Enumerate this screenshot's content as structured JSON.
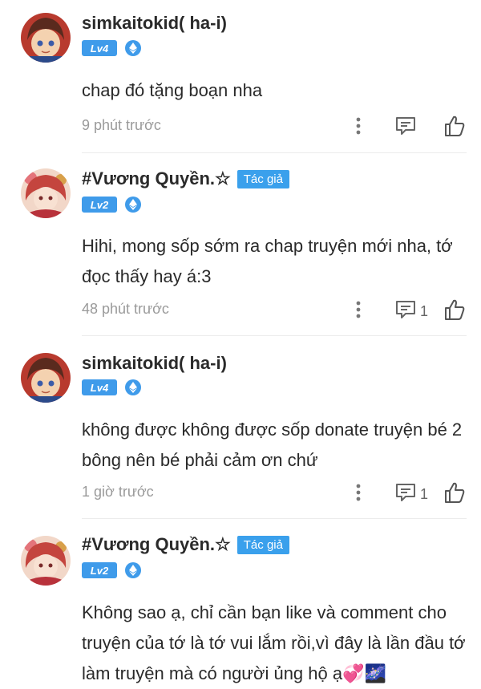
{
  "comments": [
    {
      "name": "simkaitokid( ha-i)",
      "author_badge": "",
      "level": "Lv4",
      "text": "chap đó tặng boạn nha",
      "time": "9 phút trước",
      "reply_count": ""
    },
    {
      "name": "#Vương Quyền.☆",
      "author_badge": "Tác giả",
      "level": "Lv2",
      "text": "Hihi, mong sốp sớm ra chap truyện mới nha, tớ đọc thấy hay á:3",
      "time": "48 phút trước",
      "reply_count": "1"
    },
    {
      "name": "simkaitokid( ha-i)",
      "author_badge": "",
      "level": "Lv4",
      "text": "không được không được sốp donate truyện bé 2 bông nên bé phải cảm ơn chứ",
      "time": "1 giờ trước",
      "reply_count": "1"
    },
    {
      "name": "#Vương Quyền.☆",
      "author_badge": "Tác giả",
      "level": "Lv2",
      "text": "Không sao ạ, chỉ cần bạn like và comment cho truyện của tớ là tớ vui lắm rồi,vì đây là lần đầu tớ làm truyện mà có người ủng hộ ạ💞🌌",
      "time": "",
      "reply_count": ""
    }
  ],
  "colors": {
    "accent": "#3f9bea",
    "author_badge": "#3aa0ec",
    "muted": "#9a9a9a"
  },
  "icons": [
    "avatar-boy",
    "avatar-girl",
    "ethereum-icon",
    "more-vertical-icon",
    "reply-icon",
    "thumbs-up-icon"
  ]
}
